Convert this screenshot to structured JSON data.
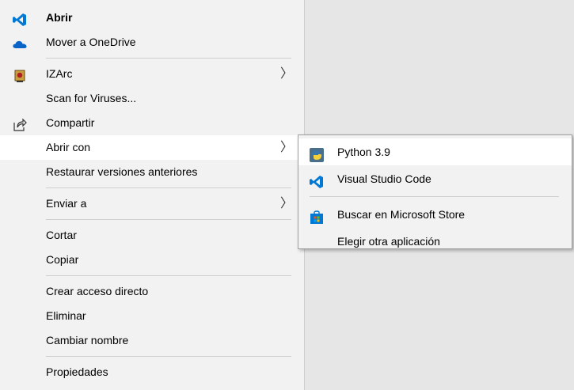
{
  "main_menu": {
    "items": [
      {
        "label": "Abrir",
        "icon": "vscode-icon"
      },
      {
        "label": "Mover a OneDrive",
        "icon": "onedrive-cloud-icon"
      },
      {
        "label": "IZArc",
        "icon": "izarc-icon",
        "submenu_arrow": "〉"
      },
      {
        "label": "Scan for Viruses..."
      },
      {
        "label": "Compartir",
        "icon": "share-icon"
      },
      {
        "label": "Abrir con",
        "submenu_arrow": "〉"
      },
      {
        "label": "Restaurar versiones anteriores"
      },
      {
        "label": "Enviar a",
        "submenu_arrow": "〉"
      },
      {
        "label": "Cortar"
      },
      {
        "label": "Copiar"
      },
      {
        "label": "Crear acceso directo"
      },
      {
        "label": "Eliminar"
      },
      {
        "label": "Cambiar nombre"
      },
      {
        "label": "Propiedades"
      }
    ]
  },
  "sub_menu": {
    "items": [
      {
        "label": "Python 3.9",
        "icon": "python-icon"
      },
      {
        "label": "Visual Studio Code",
        "icon": "vscode-icon"
      },
      {
        "label": "Buscar en Microsoft Store",
        "icon": "microsoft-store-icon"
      },
      {
        "label": "Elegir otra aplicación"
      }
    ]
  },
  "colors": {
    "menu_bg": "#f2f2f2",
    "highlight": "#ffffff",
    "desktop_bg": "#e6e6e6",
    "vscode_blue": "#0078d4",
    "onedrive_blue": "#0a64c8"
  }
}
